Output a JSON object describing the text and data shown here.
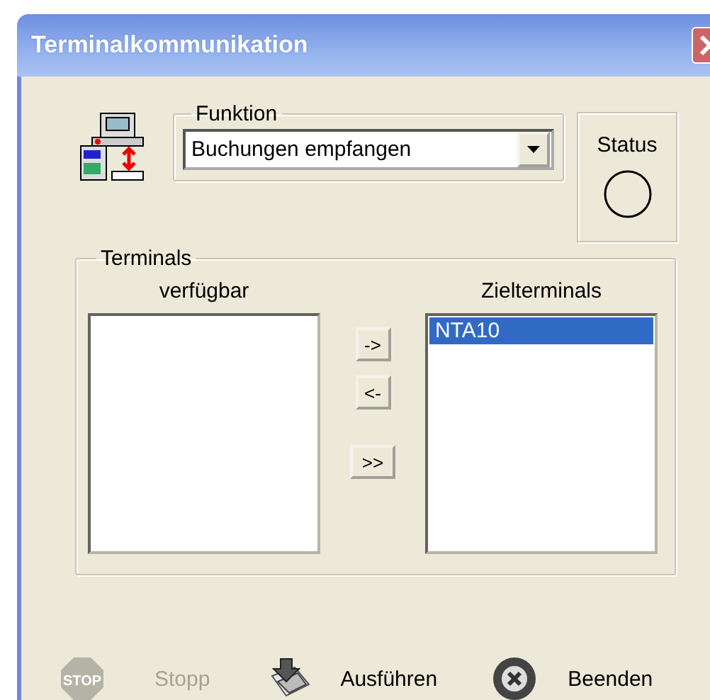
{
  "window": {
    "title": "Terminalkommunikation"
  },
  "function": {
    "label": "Funktion",
    "value": "Buchungen empfangen"
  },
  "status": {
    "label": "Status",
    "on": false
  },
  "terminals": {
    "label": "Terminals",
    "available": {
      "label": "verfügbar"
    },
    "target": {
      "label": "Zielterminals",
      "items": [
        {
          "text": "NTA10",
          "selected": true
        }
      ]
    }
  },
  "transfer_buttons": [
    "->",
    "<-",
    ">>"
  ],
  "actions": [
    {
      "kind": "stop",
      "icon_text": "STOP",
      "label": "Stopp",
      "disabled": true
    },
    {
      "kind": "run",
      "label": "Ausführen",
      "disabled": false
    },
    {
      "kind": "exit",
      "label": "Beenden",
      "disabled": false
    }
  ]
}
